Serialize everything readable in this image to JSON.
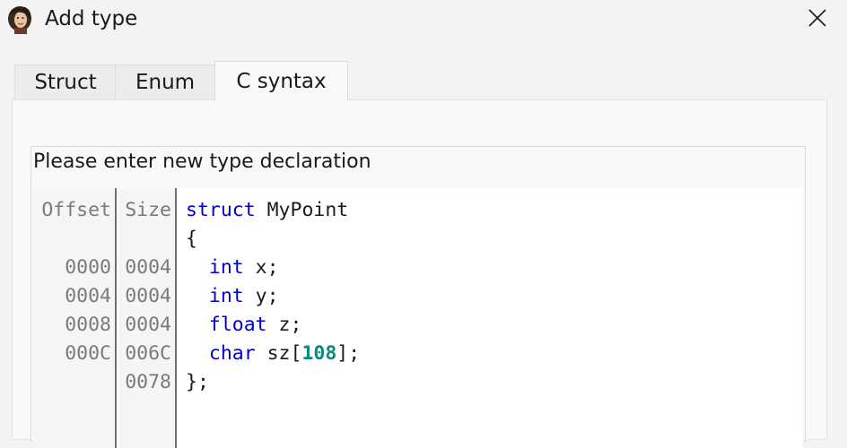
{
  "window": {
    "title": "Add type",
    "close_icon": "close-icon",
    "app_icon": "portrait-icon"
  },
  "tabs": [
    {
      "label": "Struct",
      "active": false
    },
    {
      "label": "Enum",
      "active": false
    },
    {
      "label": "C syntax",
      "active": true
    }
  ],
  "declaration": {
    "prompt": "Please enter new type declaration",
    "headers": {
      "offset": "Offset",
      "size": "Size"
    },
    "offsets": [
      "",
      "",
      "0000",
      "0004",
      "0008",
      "000C",
      ""
    ],
    "sizes": [
      "",
      "",
      "0004",
      "0004",
      "0004",
      "006C",
      "0078"
    ],
    "code": [
      {
        "kw": "struct",
        "text": " MyPoint",
        "num": "",
        "tail": ""
      },
      {
        "kw": "",
        "text": "{",
        "num": "",
        "tail": ""
      },
      {
        "kw": "  int",
        "text": " x;",
        "num": "",
        "tail": ""
      },
      {
        "kw": "  int",
        "text": " y;",
        "num": "",
        "tail": ""
      },
      {
        "kw": "  float",
        "text": " z;",
        "num": "",
        "tail": ""
      },
      {
        "kw": "  char",
        "text": " sz[",
        "num": "108",
        "tail": "];"
      },
      {
        "kw": "",
        "text": "};",
        "num": "",
        "tail": ""
      }
    ]
  },
  "colors": {
    "keyword": "#0000cc",
    "number": "#0a8a7e",
    "gutter_text": "#7a7a7a"
  }
}
